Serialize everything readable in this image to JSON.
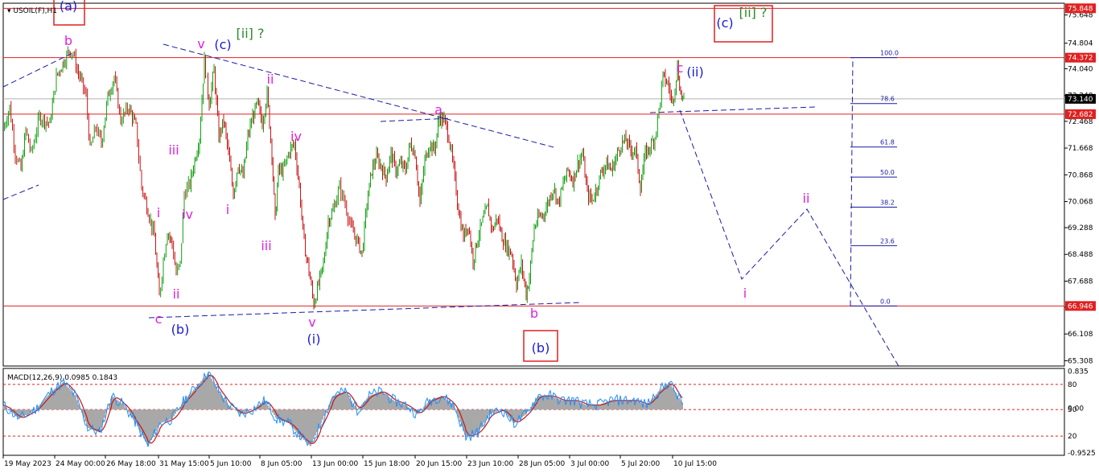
{
  "chart_data": {
    "type": "candlestick",
    "symbol_label": "USOIL(F),H1",
    "indicator_label": "MACD(12,26,9) 0.0985 0.1843",
    "price_ticks": [
      "75.648",
      "74.804",
      "74.040",
      "73.240",
      "72.468",
      "71.668",
      "70.868",
      "70.068",
      "69.288",
      "68.488",
      "67.688",
      "66.908",
      "66.108",
      "65.308"
    ],
    "x_labels": [
      "19 May 2023",
      "24 May 00:00",
      "26 May 18:00",
      "31 May 15:00",
      "5 Jun 10:00",
      "8 Jun 05:00",
      "13 Jun 00:00",
      "15 Jun 18:00",
      "20 Jun 15:00",
      "23 Jun 10:00",
      "28 Jun 05:00",
      "3 Jul 00:00",
      "5 Jul 20:00",
      "10 Jul 15:00"
    ],
    "price_range": [
      65.15,
      76.0
    ],
    "horizontal_levels": [
      {
        "label": "75.848",
        "value": 75.848
      },
      {
        "label": "74.372",
        "value": 74.372
      },
      {
        "label": "72.682",
        "value": 72.682
      },
      {
        "label": "66.946",
        "value": 66.946
      }
    ],
    "current_price": {
      "label": "73.140",
      "value": 73.14
    },
    "macd_axis_labels": [
      "0.835",
      "80",
      "0.00",
      "50",
      "20",
      "-0.9525"
    ],
    "fibonacci": [
      {
        "label": "100.0",
        "value": 74.372
      },
      {
        "label": "78.6",
        "value": 73.0
      },
      {
        "label": "61.8",
        "value": 71.7
      },
      {
        "label": "50.0",
        "value": 70.8
      },
      {
        "label": "38.2",
        "value": 69.9
      },
      {
        "label": "23.6",
        "value": 68.75
      },
      {
        "label": "0.0",
        "value": 66.946
      }
    ],
    "wave_labels": [
      {
        "text": "(a)",
        "color": "#1a1ad4",
        "boxed": true
      },
      {
        "text": "b",
        "color": "#e020e0"
      },
      {
        "text": "v",
        "color": "#e020e0"
      },
      {
        "text": "(c)",
        "color": "#1a1ad4"
      },
      {
        "text": "[ii] ?",
        "color": "#2a8a2a"
      },
      {
        "text": "ii",
        "color": "#e020e0"
      },
      {
        "text": "iii",
        "color": "#e020e0"
      },
      {
        "text": "iv",
        "color": "#e020e0"
      },
      {
        "text": "i",
        "color": "#e020e0"
      },
      {
        "text": "ii",
        "color": "#e020e0"
      },
      {
        "text": "c",
        "color": "#e020e0"
      },
      {
        "text": "(b)",
        "color": "#1a1ad4"
      },
      {
        "text": "i",
        "color": "#e020e0"
      },
      {
        "text": "iii",
        "color": "#e020e0"
      },
      {
        "text": "iv",
        "color": "#e020e0"
      },
      {
        "text": "v",
        "color": "#e020e0"
      },
      {
        "text": "(i)",
        "color": "#1a1ad4"
      },
      {
        "text": "a",
        "color": "#e020e0"
      },
      {
        "text": "b",
        "color": "#e020e0"
      },
      {
        "text": "(b)",
        "color": "#1a1ad4",
        "boxed": true
      },
      {
        "text": "c",
        "color": "#e020e0"
      },
      {
        "text": "(ii)",
        "color": "#1a1ad4"
      },
      {
        "text": "(c)",
        "color": "#1a1ad4",
        "boxed": true
      },
      {
        "text": "[ii] ?",
        "color": "#2a8a2a"
      },
      {
        "text": "i",
        "color": "#e020e0"
      },
      {
        "text": "ii",
        "color": "#e020e0"
      }
    ],
    "price_path": [
      [
        0,
        72.2
      ],
      [
        8,
        72.9
      ],
      [
        15,
        71.5
      ],
      [
        22,
        71.0
      ],
      [
        28,
        72.2
      ],
      [
        35,
        71.5
      ],
      [
        45,
        72.6
      ],
      [
        58,
        72.4
      ],
      [
        66,
        73.8
      ],
      [
        74,
        74.2
      ],
      [
        82,
        74.6
      ],
      [
        87,
        74.5
      ],
      [
        92,
        74.0
      ],
      [
        98,
        73.6
      ],
      [
        103,
        73.2
      ],
      [
        108,
        71.6
      ],
      [
        115,
        72.3
      ],
      [
        122,
        71.8
      ],
      [
        130,
        73.2
      ],
      [
        138,
        73.8
      ],
      [
        146,
        72.5
      ],
      [
        156,
        72.9
      ],
      [
        165,
        72.3
      ],
      [
        172,
        70.5
      ],
      [
        180,
        69.8
      ],
      [
        188,
        69.0
      ],
      [
        194,
        67.2
      ],
      [
        199,
        68.3
      ],
      [
        204,
        69.2
      ],
      [
        210,
        68.8
      ],
      [
        215,
        67.9
      ],
      [
        220,
        68.2
      ],
      [
        225,
        70.3
      ],
      [
        232,
        70.6
      ],
      [
        238,
        71.3
      ],
      [
        244,
        72.0
      ],
      [
        250,
        74.3
      ],
      [
        256,
        73.0
      ],
      [
        262,
        74.0
      ],
      [
        268,
        72.0
      ],
      [
        274,
        72.5
      ],
      [
        280,
        71.5
      ],
      [
        286,
        70.3
      ],
      [
        292,
        71.2
      ],
      [
        298,
        70.8
      ],
      [
        304,
        72.0
      ],
      [
        310,
        72.6
      ],
      [
        316,
        73.0
      ],
      [
        322,
        72.4
      ],
      [
        328,
        73.3
      ],
      [
        334,
        71.5
      ],
      [
        338,
        69.5
      ],
      [
        342,
        71.0
      ],
      [
        348,
        71.0
      ],
      [
        356,
        71.6
      ],
      [
        362,
        71.8
      ],
      [
        368,
        70.5
      ],
      [
        374,
        68.8
      ],
      [
        380,
        68.0
      ],
      [
        386,
        67.0
      ],
      [
        392,
        67.6
      ],
      [
        398,
        68.2
      ],
      [
        404,
        69.5
      ],
      [
        410,
        69.8
      ],
      [
        418,
        70.5
      ],
      [
        425,
        70.0
      ],
      [
        432,
        69.3
      ],
      [
        440,
        68.9
      ],
      [
        446,
        68.5
      ],
      [
        452,
        70.0
      ],
      [
        458,
        71.0
      ],
      [
        464,
        71.4
      ],
      [
        470,
        71.1
      ],
      [
        476,
        70.8
      ],
      [
        482,
        71.5
      ],
      [
        488,
        71.0
      ],
      [
        494,
        71.2
      ],
      [
        500,
        71.0
      ],
      [
        506,
        71.8
      ],
      [
        512,
        71.5
      ],
      [
        518,
        70.0
      ],
      [
        524,
        71.3
      ],
      [
        530,
        71.8
      ],
      [
        536,
        71.6
      ],
      [
        542,
        72.6
      ],
      [
        548,
        72.5
      ],
      [
        554,
        72.0
      ],
      [
        560,
        71.0
      ],
      [
        566,
        69.8
      ],
      [
        572,
        69.0
      ],
      [
        578,
        69.4
      ],
      [
        584,
        68.3
      ],
      [
        590,
        69.0
      ],
      [
        596,
        69.5
      ],
      [
        602,
        69.9
      ],
      [
        608,
        69.2
      ],
      [
        614,
        69.6
      ],
      [
        620,
        69.0
      ],
      [
        626,
        68.7
      ],
      [
        632,
        68.5
      ],
      [
        638,
        67.6
      ],
      [
        644,
        68.2
      ],
      [
        650,
        67.3
      ],
      [
        654,
        67.8
      ],
      [
        660,
        69.3
      ],
      [
        666,
        69.6
      ],
      [
        672,
        69.7
      ],
      [
        678,
        70.1
      ],
      [
        684,
        70.5
      ],
      [
        690,
        70.0
      ],
      [
        696,
        70.6
      ],
      [
        702,
        71.0
      ],
      [
        708,
        70.7
      ],
      [
        714,
        71.2
      ],
      [
        720,
        71.5
      ],
      [
        726,
        70.3
      ],
      [
        732,
        70.1
      ],
      [
        738,
        70.5
      ],
      [
        744,
        71.0
      ],
      [
        750,
        71.2
      ],
      [
        756,
        71.0
      ],
      [
        762,
        71.4
      ],
      [
        768,
        71.8
      ],
      [
        774,
        71.9
      ],
      [
        780,
        71.6
      ],
      [
        786,
        71.6
      ],
      [
        792,
        70.5
      ],
      [
        798,
        71.5
      ],
      [
        804,
        71.7
      ],
      [
        810,
        72.0
      ],
      [
        815,
        72.8
      ],
      [
        820,
        73.8
      ],
      [
        826,
        73.6
      ],
      [
        832,
        73.0
      ],
      [
        838,
        74.1
      ],
      [
        842,
        73.3
      ],
      [
        846,
        73.1
      ]
    ],
    "macd_path": [
      [
        0,
        0.1
      ],
      [
        20,
        -0.2
      ],
      [
        40,
        0.0
      ],
      [
        60,
        0.4
      ],
      [
        75,
        0.6
      ],
      [
        90,
        0.3
      ],
      [
        105,
        -0.4
      ],
      [
        120,
        -0.5
      ],
      [
        135,
        0.3
      ],
      [
        150,
        0.1
      ],
      [
        165,
        -0.3
      ],
      [
        180,
        -0.8
      ],
      [
        195,
        -0.3
      ],
      [
        210,
        -0.2
      ],
      [
        225,
        0.2
      ],
      [
        240,
        0.5
      ],
      [
        255,
        0.8
      ],
      [
        268,
        0.4
      ],
      [
        280,
        0.1
      ],
      [
        295,
        -0.1
      ],
      [
        310,
        0.0
      ],
      [
        325,
        0.2
      ],
      [
        340,
        -0.2
      ],
      [
        355,
        -0.3
      ],
      [
        370,
        -0.6
      ],
      [
        382,
        -0.8
      ],
      [
        395,
        -0.3
      ],
      [
        410,
        0.3
      ],
      [
        425,
        0.4
      ],
      [
        440,
        0.0
      ],
      [
        455,
        0.3
      ],
      [
        470,
        0.4
      ],
      [
        485,
        0.2
      ],
      [
        500,
        0.1
      ],
      [
        515,
        -0.1
      ],
      [
        530,
        0.2
      ],
      [
        545,
        0.3
      ],
      [
        560,
        0.1
      ],
      [
        575,
        -0.6
      ],
      [
        590,
        -0.5
      ],
      [
        605,
        -0.1
      ],
      [
        620,
        0.0
      ],
      [
        635,
        -0.3
      ],
      [
        650,
        -0.1
      ],
      [
        665,
        0.3
      ],
      [
        680,
        0.3
      ],
      [
        695,
        0.2
      ],
      [
        710,
        0.2
      ],
      [
        725,
        0.1
      ],
      [
        740,
        0.1
      ],
      [
        755,
        0.2
      ],
      [
        770,
        0.2
      ],
      [
        785,
        0.2
      ],
      [
        800,
        0.1
      ],
      [
        815,
        0.4
      ],
      [
        828,
        0.6
      ],
      [
        838,
        0.3
      ],
      [
        846,
        0.1
      ]
    ]
  }
}
